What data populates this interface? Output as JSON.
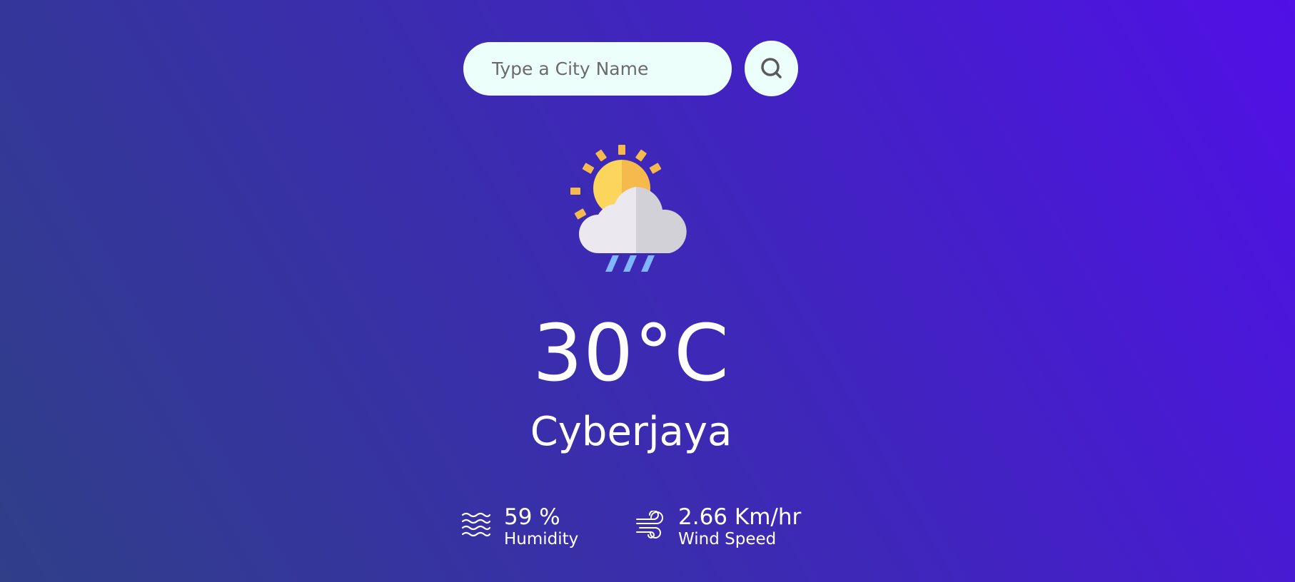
{
  "search": {
    "placeholder": "Type a City Name",
    "value": ""
  },
  "search_button": {
    "icon": "search-icon"
  },
  "weather": {
    "icon": "sun-cloud-rain-icon",
    "temperature": "30°C",
    "city": "Cyberjaya"
  },
  "details": {
    "humidity": {
      "icon": "humidity-waves-icon",
      "value": "59 %",
      "label": "Humidity"
    },
    "wind": {
      "icon": "wind-icon",
      "value": "2.66 Km/hr",
      "label": "Wind Speed"
    }
  },
  "colors": {
    "search_bg": "#ecfffb",
    "gradient_start": "#2f3f88",
    "gradient_end": "#5010e6",
    "sun": "#fcd55c",
    "sun_shade": "#f6b94c",
    "cloud": "#ece8ef",
    "cloud_shade": "#d3d1d8",
    "rain": "#7fb6ff"
  }
}
